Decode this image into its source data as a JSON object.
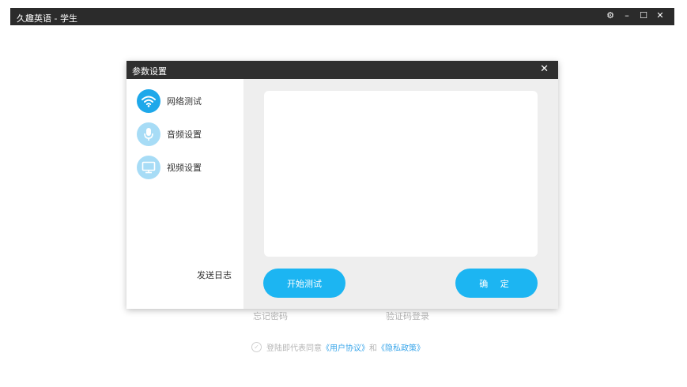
{
  "window": {
    "title": "久趣英语 - 学生",
    "controls": [
      "⚙",
      "–",
      "☐",
      "✕"
    ]
  },
  "background": {
    "forgot_password": "忘记密码",
    "code_login": "验证码登录",
    "agree_prefix": "登陆即代表同意",
    "user_agreement": "《用户协议》",
    "and": "和",
    "privacy_policy": "《隐私政策》"
  },
  "dialog": {
    "title": "参数设置",
    "close": "✕",
    "nav": [
      {
        "label": "网络测试",
        "icon": "wifi-icon",
        "active": true
      },
      {
        "label": "音频设置",
        "icon": "microphone-icon",
        "active": false
      },
      {
        "label": "视频设置",
        "icon": "monitor-icon",
        "active": false
      }
    ],
    "send_log": "发送日志",
    "start_test": "开始测试",
    "confirm": "确 定"
  }
}
